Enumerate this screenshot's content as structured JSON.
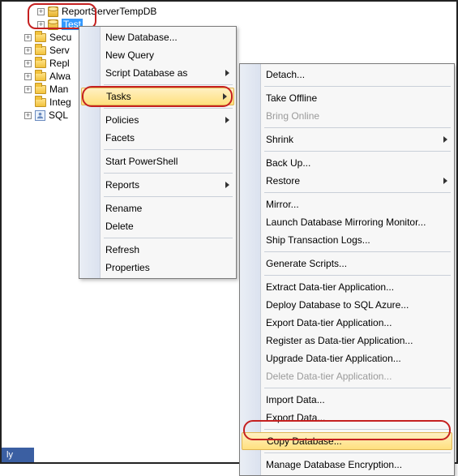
{
  "tree": {
    "db1": "ReportServerTempDB",
    "db2": "Test",
    "f1": "Secu",
    "f2": "Serv",
    "f3": "Repl",
    "f4": "Alwa",
    "f5": "Man",
    "f6": "Integ",
    "sql": "SQL"
  },
  "menu1": {
    "new_database": "New Database...",
    "new_query": "New Query",
    "script_database_as": "Script Database as",
    "tasks": "Tasks",
    "policies": "Policies",
    "facets": "Facets",
    "start_powershell": "Start PowerShell",
    "reports": "Reports",
    "rename": "Rename",
    "delete": "Delete",
    "refresh": "Refresh",
    "properties": "Properties"
  },
  "menu2": {
    "detach": "Detach...",
    "take_offline": "Take Offline",
    "bring_online": "Bring Online",
    "shrink": "Shrink",
    "back_up": "Back Up...",
    "restore": "Restore",
    "mirror": "Mirror...",
    "launch_mirroring": "Launch Database Mirroring Monitor...",
    "ship_logs": "Ship Transaction Logs...",
    "gen_scripts": "Generate Scripts...",
    "extract_dta": "Extract Data-tier Application...",
    "deploy_azure": "Deploy Database to SQL Azure...",
    "export_dta": "Export Data-tier Application...",
    "register_dta": "Register as Data-tier Application...",
    "upgrade_dta": "Upgrade Data-tier Application...",
    "delete_dta": "Delete Data-tier Application...",
    "import_data": "Import Data...",
    "export_data": "Export Data...",
    "copy_database": "Copy Database...",
    "manage_encryption": "Manage Database Encryption..."
  },
  "footer": "ly"
}
